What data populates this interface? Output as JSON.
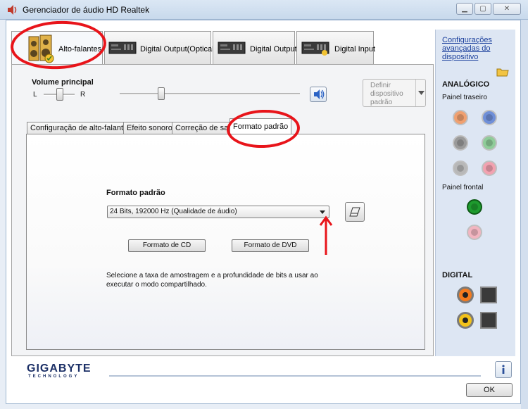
{
  "window": {
    "title": "Gerenciador de áudio HD Realtek",
    "controls": [
      "minimize-icon",
      "maximize-icon",
      "close-icon"
    ]
  },
  "device_tabs": [
    {
      "label": "Alto-falantes",
      "icon": "speakers-icon",
      "active": true
    },
    {
      "label": "Digital Output(Optical)",
      "icon": "hardware-device-icon",
      "active": false
    },
    {
      "label": "Digital Output",
      "icon": "hardware-device-icon",
      "active": false
    },
    {
      "label": "Digital Input",
      "icon": "hardware-device-icon",
      "active": false
    }
  ],
  "volume": {
    "label": "Volume principal",
    "left_label": "L",
    "right_label": "R"
  },
  "default_device_button": "Definir dispositivo padrão",
  "sub_tabs": [
    {
      "label": "Configuração de alto-falante",
      "active": false
    },
    {
      "label": "Efeito sonoro",
      "active": false
    },
    {
      "label": "Correção de sala",
      "active": false
    },
    {
      "label": "Formato padrão",
      "active": true
    }
  ],
  "format": {
    "heading": "Formato padrão",
    "selected": "24 Bits, 192000 Hz (Qualidade de áudio)",
    "cd_button": "Formato de CD",
    "dvd_button": "Formato de DVD",
    "description": "Selecione a taxa de amostragem e a profundidade de bits a usar ao executar o modo compartilhado."
  },
  "side_panel": {
    "advanced_link": "Configurações avançadas do dispositivo",
    "analog_heading": "ANALÓGICO",
    "rear_panel_label": "Painel traseiro",
    "front_panel_label": "Painel frontal",
    "digital_heading": "DIGITAL",
    "rear_jack_colors": [
      "#f0a070",
      "#6f8fd8",
      "#9a9a9a",
      "#8fcc99",
      "#b8b8b8",
      "#f2a2b0"
    ],
    "front_jack_colors": [
      "#1e9b2e",
      "#f2b5c0"
    ],
    "digital_rca_colors": [
      "#f47a1e",
      "#f2c21a"
    ]
  },
  "brand": {
    "logo": "GIGABYTE",
    "sub": "TECHNOLOGY"
  },
  "ok_button": "OK",
  "annotation_color": "#e8141a"
}
